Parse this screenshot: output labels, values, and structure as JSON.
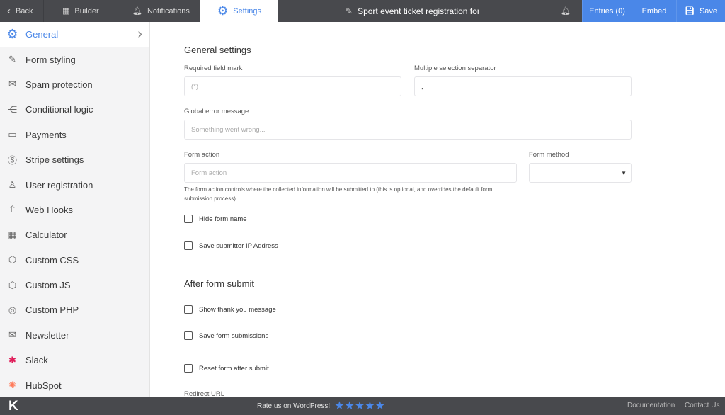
{
  "topbar": {
    "back": "Back",
    "builder": "Builder",
    "notifications": "Notifications",
    "settings": "Settings",
    "form_title": "Sport event ticket registration form",
    "entries": "Entries (0)",
    "embed": "Embed",
    "save": "Save"
  },
  "sidebar": {
    "items": [
      {
        "label": "General",
        "icon": "gear-icon"
      },
      {
        "label": "Form styling",
        "icon": "brush-icon"
      },
      {
        "label": "Spam protection",
        "icon": "shield-mail-icon"
      },
      {
        "label": "Conditional logic",
        "icon": "share-nodes-icon"
      },
      {
        "label": "Payments",
        "icon": "credit-card-icon"
      },
      {
        "label": "Stripe settings",
        "icon": "stripe-icon"
      },
      {
        "label": "User registration",
        "icon": "user-icon"
      },
      {
        "label": "Web Hooks",
        "icon": "upload-icon"
      },
      {
        "label": "Calculator",
        "icon": "calculator-icon"
      },
      {
        "label": "Custom CSS",
        "icon": "css-icon"
      },
      {
        "label": "Custom JS",
        "icon": "js-icon"
      },
      {
        "label": "Custom PHP",
        "icon": "php-icon"
      },
      {
        "label": "Newsletter",
        "icon": "envelope-icon"
      },
      {
        "label": "Slack",
        "icon": "slack-icon"
      },
      {
        "label": "HubSpot",
        "icon": "hubspot-icon"
      }
    ]
  },
  "main": {
    "general_heading": "General settings",
    "required_mark_label": "Required field mark",
    "required_mark_placeholder": "(*)",
    "separator_label": "Multiple selection separator",
    "separator_value": ",",
    "error_label": "Global error message",
    "error_placeholder": "Something went wrong...",
    "action_label": "Form action",
    "action_placeholder": "Form action",
    "method_label": "Form method",
    "method_value": "",
    "action_help": "The form action controls where the collected information will be submitted to (this is optional, and overrides the default form submission process).",
    "hide_name": "Hide form name",
    "save_ip": "Save submitter IP Address",
    "after_heading": "After form submit",
    "show_thanks": "Show thank you message",
    "save_submissions": "Save form submissions",
    "reset_form": "Reset form after submit",
    "redirect_label": "Redirect URL"
  },
  "footer": {
    "logo": "K",
    "rate": "Rate us on WordPress!",
    "stars": 5,
    "documentation": "Documentation",
    "contact": "Contact Us"
  },
  "colors": {
    "accent": "#4a87e8",
    "dark": "#48494d"
  }
}
